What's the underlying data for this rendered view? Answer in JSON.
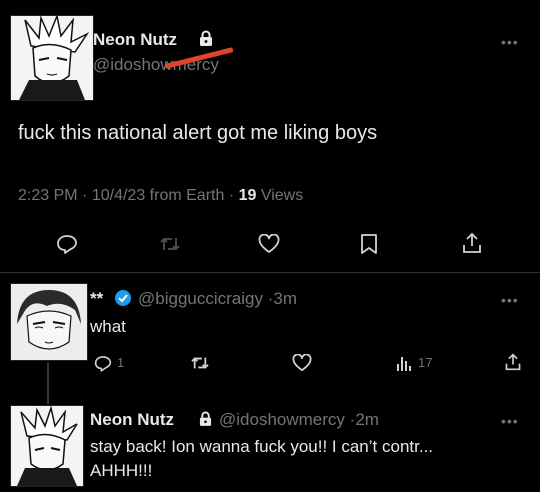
{
  "main_tweet": {
    "display_name": "Neon Nutz",
    "handle": "@idoshowmercy",
    "text": "fuck this national alert got me liking boys",
    "time": "2:23 PM",
    "date": "10/4/23",
    "source": "from Earth",
    "views_count": "19",
    "views_label": "Views"
  },
  "reply1": {
    "display_name": "**",
    "handle": "@bigguccicraigy",
    "time": "3m",
    "text": "what",
    "reply_count": "1",
    "views_count": "17"
  },
  "reply2": {
    "display_name": "Neon Nutz",
    "handle": "@idoshowmercy",
    "time": "2m",
    "text_line1": "stay back! Ion wanna fuck you!! I can’t contr...",
    "text_line2": "AHHH!!!"
  },
  "colors": {
    "background": "#000000",
    "text": "#e7e9ea",
    "muted": "#71767b",
    "verified": "#1d9bf0",
    "strike": "#e0442a"
  },
  "icons": [
    "lock-icon",
    "reply-icon",
    "retweet-icon",
    "like-icon",
    "bookmark-icon",
    "share-icon",
    "verified-icon",
    "views-icon",
    "more-icon"
  ]
}
